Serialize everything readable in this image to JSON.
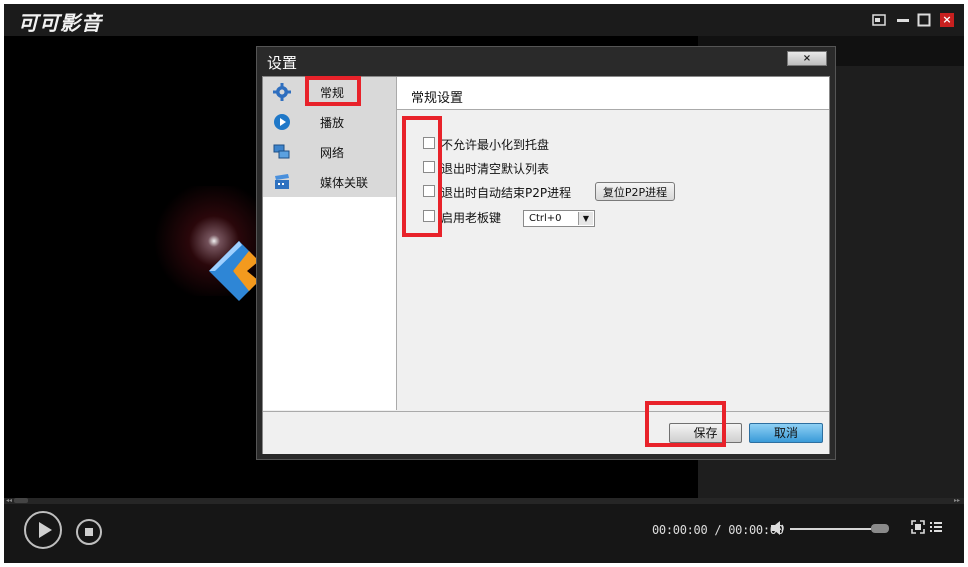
{
  "app": {
    "title": "可可影音"
  },
  "window_controls": {
    "compact_icon": "compact-mode-icon",
    "minimize_icon": "minimize-icon",
    "maximize_icon": "maximize-icon",
    "close_icon": "close-icon",
    "close_glyph": "×"
  },
  "dialog": {
    "title": "设置",
    "close_glyph": "×",
    "nav": [
      {
        "label": "常规",
        "icon": "gear-icon"
      },
      {
        "label": "播放",
        "icon": "play-icon"
      },
      {
        "label": "网络",
        "icon": "network-icon"
      },
      {
        "label": "媒体关联",
        "icon": "clapperboard-icon"
      }
    ],
    "section_title": "常规设置",
    "options": [
      {
        "label": "不允许最小化到托盘",
        "checked": false
      },
      {
        "label": "退出时清空默认列表",
        "checked": false
      },
      {
        "label": "退出时自动结束P2P进程",
        "checked": false
      },
      {
        "label": "启用老板键",
        "checked": false
      }
    ],
    "reset_p2p_label": "复位P2P进程",
    "boss_key_value": "Ctrl+0",
    "save_label": "保存",
    "cancel_label": "取消"
  },
  "player": {
    "time_current": "00:00:00",
    "time_separator": "/",
    "time_total": "00:00:00",
    "volume_level": 0.95
  },
  "colors": {
    "highlight": "#e8222a",
    "accent_blue": "#3a9ad8"
  }
}
